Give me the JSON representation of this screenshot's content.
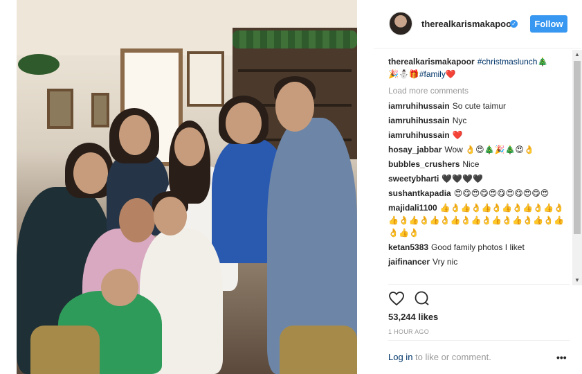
{
  "post": {
    "username": "therealkarismakapoor",
    "follow_label": "Follow",
    "caption": {
      "username": "therealkarismakapoor",
      "tag1": "#christmaslunch",
      "emoji1": "🎄",
      "emoji2": "🎉⛄🎁",
      "tag2": "#family",
      "emoji3": "❤️"
    },
    "load_more": "Load more comments",
    "comments": [
      {
        "user": "iamruhihussain",
        "text": "So cute taimur"
      },
      {
        "user": "iamruhihussain",
        "text": "Nyc"
      },
      {
        "user": "iamruhihussain",
        "text": "❤️"
      },
      {
        "user": "hosay_jabbar",
        "text": "Wow 👌😍🎄🎉🎄😍👌"
      },
      {
        "user": "bubbles_crushers",
        "text": "Nice"
      },
      {
        "user": "sweetybharti",
        "text": "🖤🖤🖤🖤"
      },
      {
        "user": "sushantkapadia",
        "text": "😍😋😍😋😍😋😍😋😍😋😍"
      },
      {
        "user": "majidali1100",
        "text": "👍👌👍👌👍👌👍👌👍👌👍👌👍👌👍👌👍👌👍👌👍👌👍👌👍👌👍👌👍👌👍👌"
      },
      {
        "user": "ketan5383",
        "text": "Good family photos I liket"
      },
      {
        "user": "jaifinancer",
        "text": "Vry nic"
      }
    ],
    "likes": "53,244 likes",
    "time": "1 HOUR AGO",
    "login_link": "Log in",
    "login_rest": " to like or comment.",
    "more_options": "•••",
    "verified_glyph": "✓"
  },
  "colors": {
    "accent": "#3897f0",
    "link": "#003569",
    "muted": "#999999"
  },
  "icons": [
    "heart-icon",
    "comment-icon",
    "verified-icon",
    "more-options-icon"
  ]
}
